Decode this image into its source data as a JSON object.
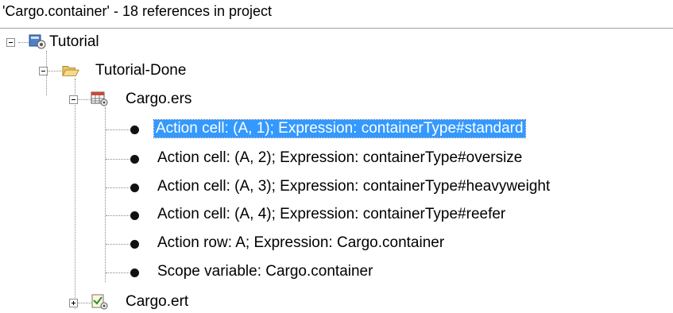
{
  "header": {
    "title": "'Cargo.container' - 18 references in project"
  },
  "tree": {
    "project": {
      "label": "Tutorial",
      "icon": "project-icon"
    },
    "folder": {
      "label": "Tutorial-Done",
      "icon": "folder-open-icon"
    },
    "ers_file": {
      "label": "Cargo.ers",
      "icon": "ers-file-icon",
      "children": [
        {
          "label": "Action cell: (A, 1); Expression: containerType#standard",
          "selected": true
        },
        {
          "label": "Action cell: (A, 2); Expression: containerType#oversize"
        },
        {
          "label": "Action cell: (A, 3); Expression: containerType#heavyweight"
        },
        {
          "label": "Action cell: (A, 4); Expression: containerType#reefer"
        },
        {
          "label": "Action row: A; Expression: Cargo.container"
        },
        {
          "label": "Scope variable: Cargo.container"
        }
      ]
    },
    "ert_file": {
      "label": "Cargo.ert",
      "icon": "ert-file-icon"
    }
  },
  "colors": {
    "selection": "#3399ff",
    "selection_text": "#ffffff"
  }
}
